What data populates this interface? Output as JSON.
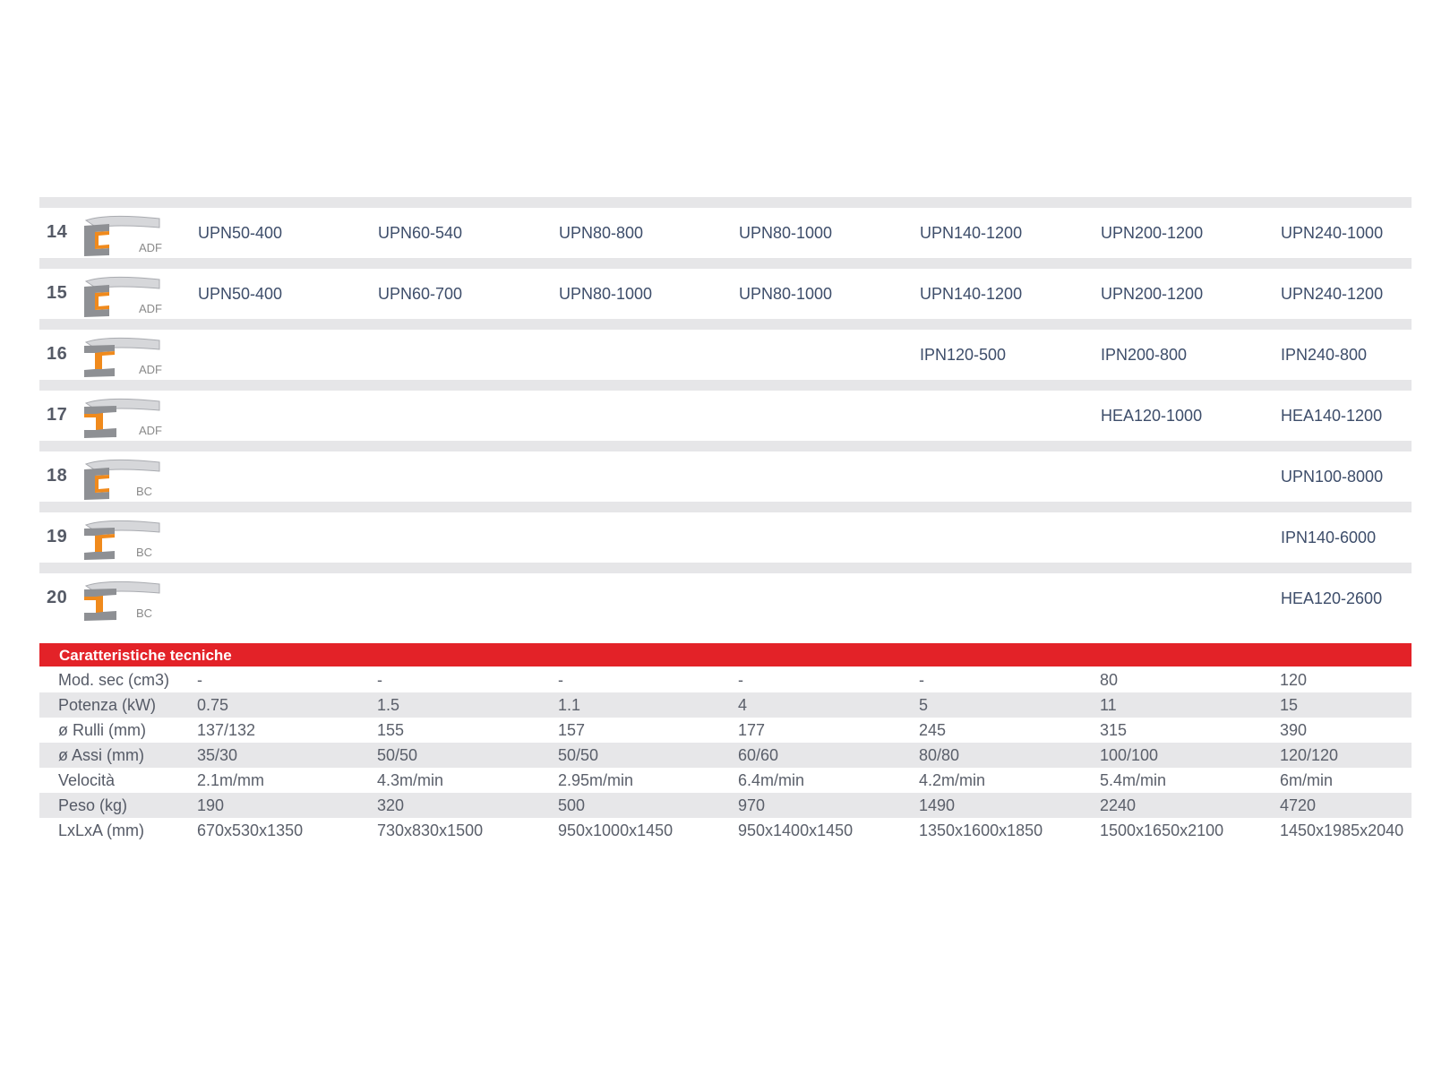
{
  "colors": {
    "accent": "#e32228",
    "profile_orange": "#f08a1c",
    "profile_grey": "#8e9094",
    "row_separator": "#e6e6e8"
  },
  "profiles": [
    {
      "number": "14",
      "icon": "upn-profile-icon",
      "tag": "ADF",
      "values": [
        "UPN50-400",
        "UPN60-540",
        "UPN80-800",
        "UPN80-1000",
        "UPN140-1200",
        "UPN200-1200",
        "UPN240-1000"
      ]
    },
    {
      "number": "15",
      "icon": "upn-profile-icon",
      "tag": "ADF",
      "values": [
        "UPN50-400",
        "UPN60-700",
        "UPN80-1000",
        "UPN80-1000",
        "UPN140-1200",
        "UPN200-1200",
        "UPN240-1200"
      ]
    },
    {
      "number": "16",
      "icon": "ipn-profile-icon",
      "tag": "ADF",
      "values": [
        "",
        "",
        "",
        "",
        "IPN120-500",
        "IPN200-800",
        "IPN240-800"
      ]
    },
    {
      "number": "17",
      "icon": "hea-profile-icon",
      "tag": "ADF",
      "values": [
        "",
        "",
        "",
        "",
        "",
        "HEA120-1000",
        "HEA140-1200"
      ]
    },
    {
      "number": "18",
      "icon": "upn-profile-icon",
      "tag": "BC",
      "values": [
        "",
        "",
        "",
        "",
        "",
        "",
        "UPN100-8000"
      ]
    },
    {
      "number": "19",
      "icon": "ipn-profile-icon",
      "tag": "BC",
      "values": [
        "",
        "",
        "",
        "",
        "",
        "",
        "IPN140-6000"
      ]
    },
    {
      "number": "20",
      "icon": "hea-profile-icon",
      "tag": "BC",
      "values": [
        "",
        "",
        "",
        "",
        "",
        "",
        "HEA120-2600"
      ]
    }
  ],
  "tech": {
    "title": "Caratteristiche tecniche",
    "rows": [
      {
        "label": "Mod. sec (cm3)",
        "values": [
          "-",
          "-",
          "-",
          "-",
          "-",
          "80",
          "120"
        ]
      },
      {
        "label": "Potenza (kW)",
        "values": [
          "0.75",
          "1.5",
          "1.1",
          "4",
          "5",
          "11",
          "15"
        ]
      },
      {
        "label": "ø Rulli (mm)",
        "values": [
          "137/132",
          "155",
          "157",
          "177",
          "245",
          "315",
          "390"
        ]
      },
      {
        "label": "ø Assi (mm)",
        "values": [
          "35/30",
          "50/50",
          "50/50",
          "60/60",
          "80/80",
          "100/100",
          "120/120"
        ]
      },
      {
        "label": "Velocità",
        "values": [
          "2.1m/mm",
          "4.3m/min",
          "2.95m/min",
          "6.4m/min",
          "4.2m/min",
          "5.4m/min",
          "6m/min"
        ]
      },
      {
        "label": "Peso (kg)",
        "values": [
          "190",
          "320",
          "500",
          "970",
          "1490",
          "2240",
          "4720"
        ]
      },
      {
        "label": "LxLxA (mm)",
        "values": [
          "670x530x1350",
          "730x830x1500",
          "950x1000x1450",
          "950x1400x1450",
          "1350x1600x1850",
          "1500x1650x2100",
          "1450x1985x2040"
        ]
      }
    ]
  }
}
